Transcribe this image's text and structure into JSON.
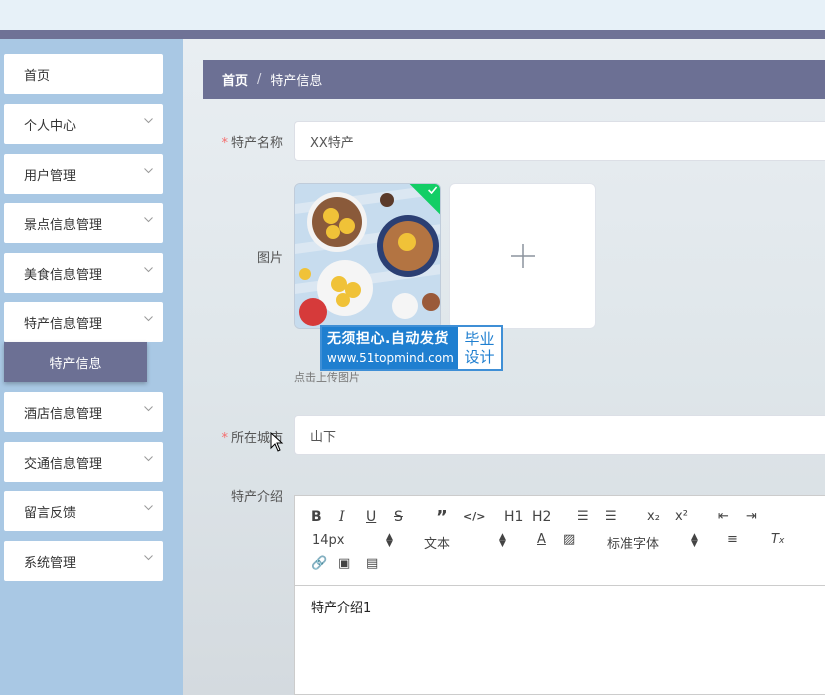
{
  "sidebar": {
    "items": [
      {
        "label": "首页",
        "has_arrow": false
      },
      {
        "label": "个人中心",
        "has_arrow": true
      },
      {
        "label": "用户管理",
        "has_arrow": true
      },
      {
        "label": "景点信息管理",
        "has_arrow": true
      },
      {
        "label": "美食信息管理",
        "has_arrow": true
      },
      {
        "label": "特产信息管理",
        "has_arrow": true
      },
      {
        "label": "酒店信息管理",
        "has_arrow": true
      },
      {
        "label": "交通信息管理",
        "has_arrow": true
      },
      {
        "label": "留言反馈",
        "has_arrow": true
      },
      {
        "label": "系统管理",
        "has_arrow": true
      }
    ],
    "active_sub_item": "特产信息"
  },
  "breadcrumb": {
    "home": "首页",
    "separator": "/",
    "current": "特产信息"
  },
  "form": {
    "name_label": "特产名称",
    "name_value": "XX特产",
    "image_label": "图片",
    "upload_tip": "点击上传图片",
    "city_label": "所在城市",
    "city_value": "山下",
    "intro_label": "特产介绍",
    "required_mark": "*"
  },
  "watermark": {
    "line1": "无须担心.自动发货",
    "line2": "www.51topmind.com",
    "right1": "毕业",
    "right2": "设计"
  },
  "editor": {
    "toolbar": {
      "font_size": "14px",
      "paragraph": "文本",
      "font_family": "标准字体",
      "h1": "H1",
      "h2": "H2"
    },
    "content": "特产介绍1"
  },
  "colors": {
    "accent": "#6c7094",
    "sidebar_bg": "#a9c8e4",
    "success": "#13ce66",
    "required": "#f56c6c"
  }
}
